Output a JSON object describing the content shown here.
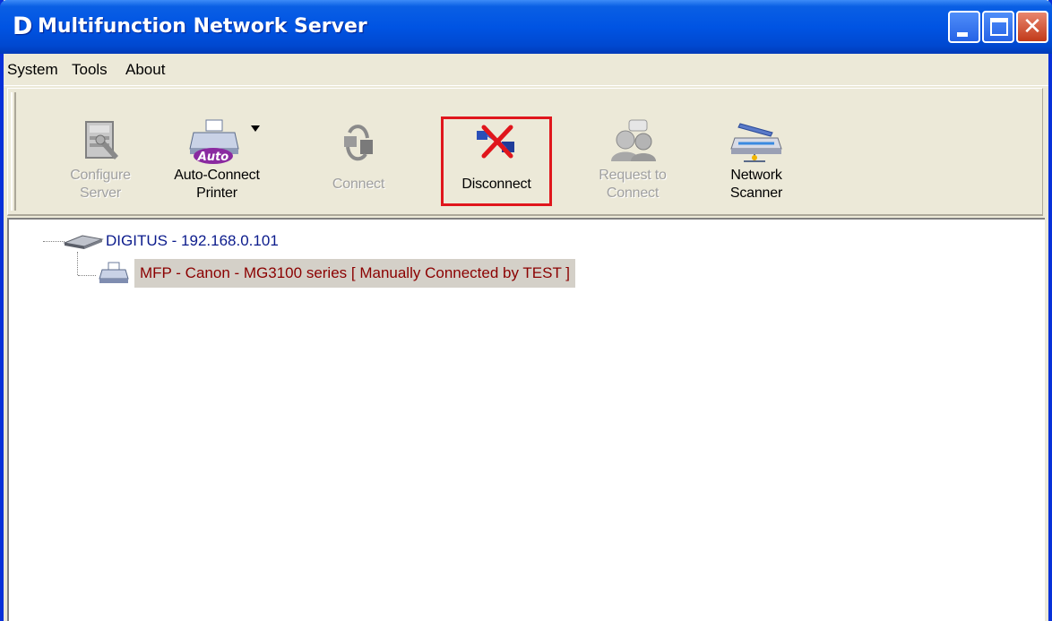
{
  "window": {
    "logo_letter": "D",
    "title": "Multifunction Network Server",
    "close_glyph": "✕"
  },
  "menu": {
    "items": [
      "System",
      "Tools",
      "About"
    ]
  },
  "toolbar": {
    "configure": {
      "line1": "Configure",
      "line2": "Server",
      "icon": "configure-server-icon",
      "enabled": false
    },
    "autoconnect": {
      "line1": "Auto-Connect",
      "line2": "Printer",
      "icon": "auto-connect-printer-icon",
      "badge": "Auto",
      "enabled": true
    },
    "connect": {
      "line1": "Connect",
      "icon": "connect-icon",
      "enabled": false
    },
    "disconnect": {
      "line1": "Disconnect",
      "icon": "disconnect-icon",
      "enabled": true,
      "highlight_color": "#e0161c"
    },
    "request": {
      "line1": "Request to",
      "line2": "Connect",
      "icon": "request-connect-icon",
      "enabled": false
    },
    "scanner": {
      "line1": "Network",
      "line2": "Scanner",
      "icon": "network-scanner-icon",
      "enabled": true
    }
  },
  "tree": {
    "server": {
      "label": "DIGITUS - 192.168.0.101",
      "icon": "server-device-icon",
      "color": "#0b1b8c"
    },
    "printer": {
      "label": "MFP - Canon - MG3100 series [ Manually Connected by TEST ]",
      "icon": "printer-icon",
      "color": "#8b0000"
    }
  },
  "colors": {
    "titlebar": "#0054e3",
    "window_bg": "#ece9d8"
  }
}
